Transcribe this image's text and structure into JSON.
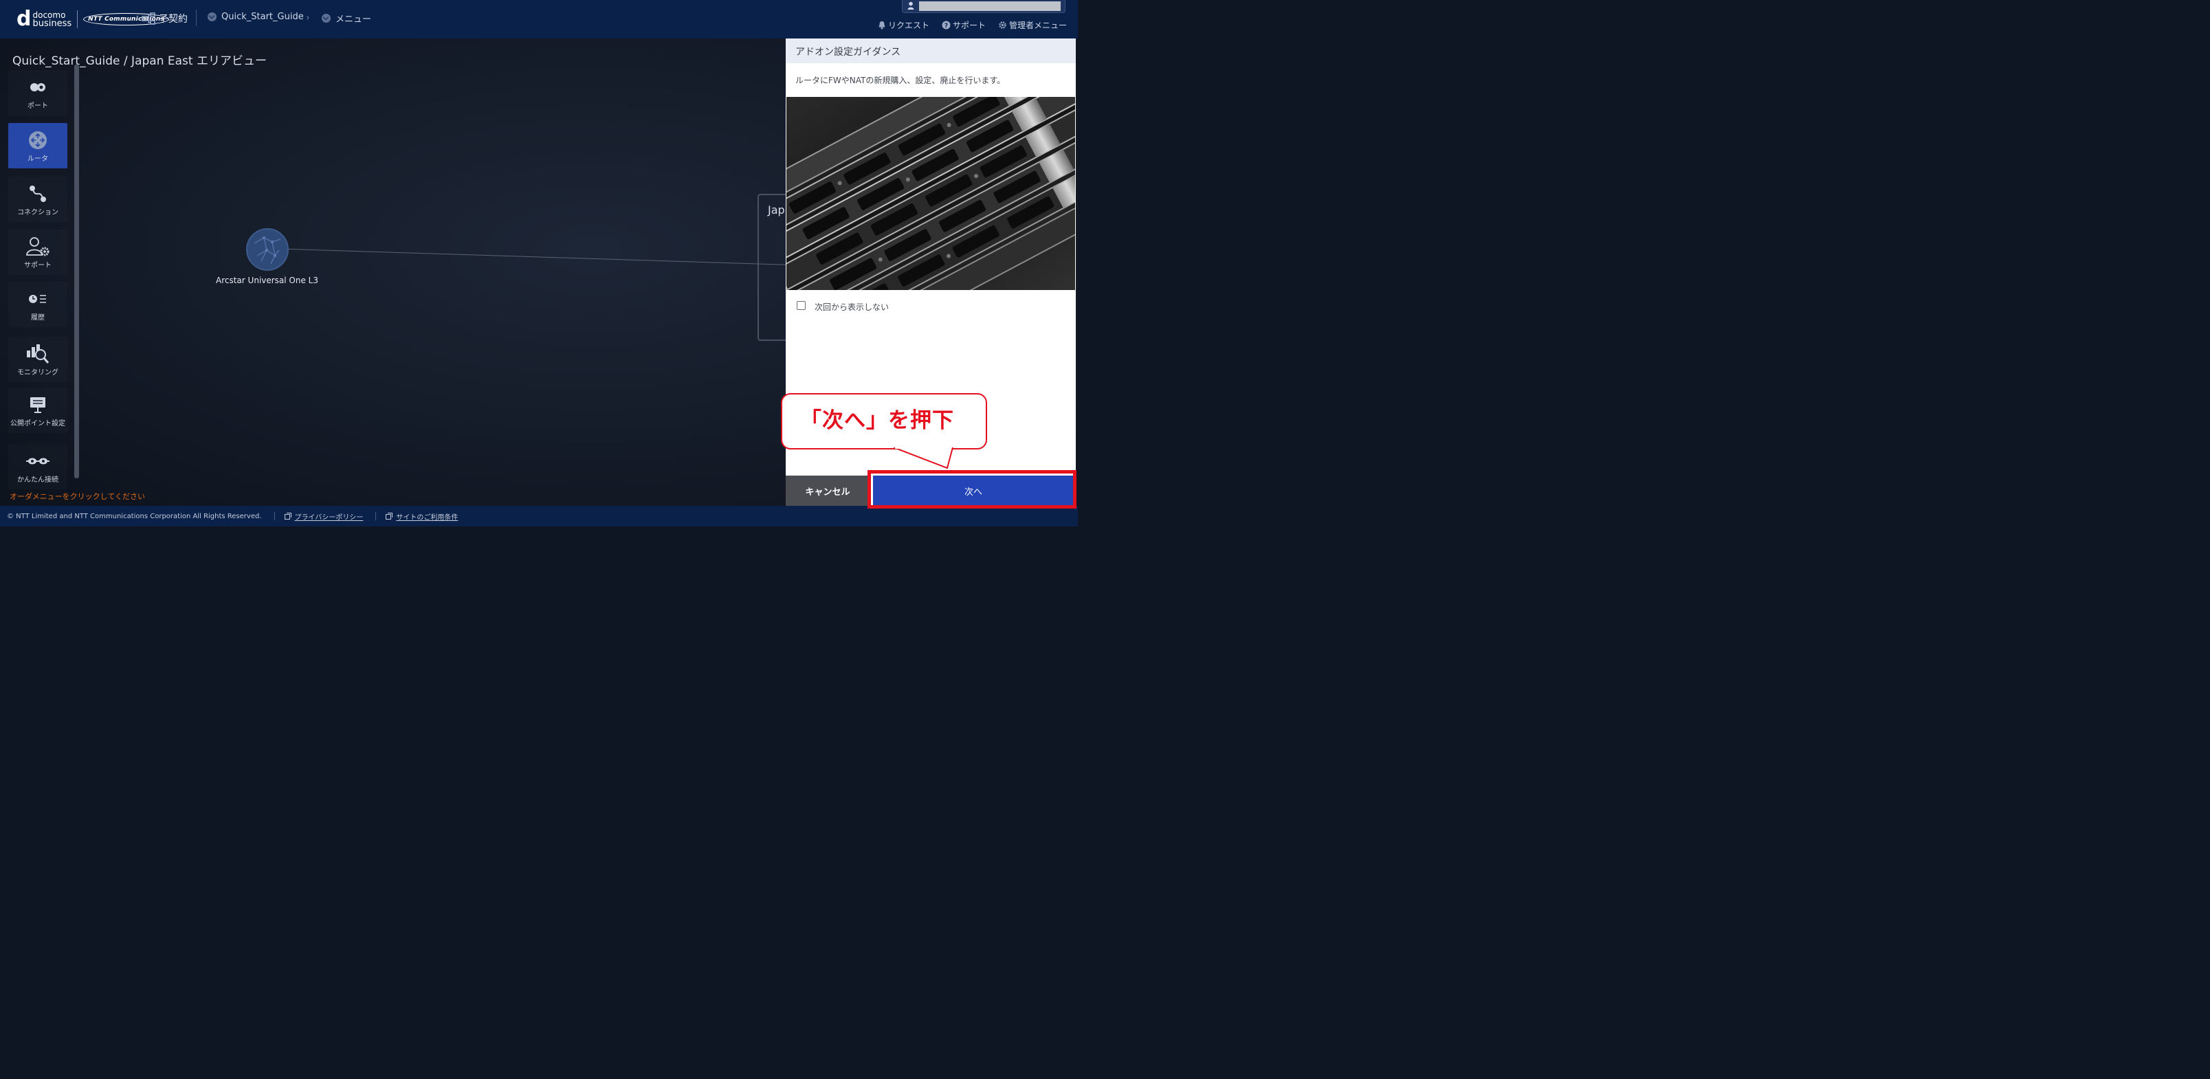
{
  "header": {
    "brand_line1": "docomo",
    "brand_line2": "business",
    "ntt_logo_text": "NTT Communications",
    "contract_label": "子契約",
    "breadcrumb": [
      "Quick_Start_Guide",
      "メニュー"
    ],
    "links": {
      "request": "リクエスト",
      "support": "サポート",
      "admin_menu": "管理者メニュー"
    }
  },
  "page": {
    "title": "Quick_Start_Guide / Japan East エリアビュー",
    "order_hint": "オーダメニューをクリックしてください"
  },
  "sidebar": {
    "items": [
      {
        "label": "ポート",
        "icon": "port-icon",
        "active": false
      },
      {
        "label": "ルータ",
        "icon": "router-icon",
        "active": true
      },
      {
        "label": "コネクション",
        "icon": "connection-icon",
        "active": false
      },
      {
        "label": "サポート",
        "icon": "support-user-icon",
        "active": false
      },
      {
        "label": "履歴",
        "icon": "history-icon",
        "active": false
      },
      {
        "label": "モニタリング",
        "icon": "monitoring-icon",
        "active": false
      },
      {
        "label": "公開ポイント設定",
        "icon": "public-point-icon",
        "active": false
      },
      {
        "label": "かんたん接続",
        "icon": "easy-connect-icon",
        "active": false
      }
    ]
  },
  "canvas": {
    "node_label": "Arcstar Universal One L3",
    "region_label": "Jap"
  },
  "panel": {
    "title": "アドオン設定ガイダンス",
    "description": "ルータにFWやNATの新規購入、設定、廃止を行います。",
    "image_alt": "server-rack-photo",
    "checkbox_label": "次回から表示しない",
    "checkbox_checked": false,
    "cancel_label": "キャンセル",
    "next_label": "次へ"
  },
  "annotation": {
    "callout_text": "「次へ」を押下",
    "color": "#e5111f"
  },
  "footer": {
    "copyright": "© NTT Limited and NTT Communications Corporation All Rights Reserved.",
    "privacy": "プライバシーポリシー",
    "terms": "サイトのご利用条件"
  },
  "colors": {
    "topbar": "#0a2149",
    "accent": "#2445b8",
    "hint": "#e36a15"
  }
}
